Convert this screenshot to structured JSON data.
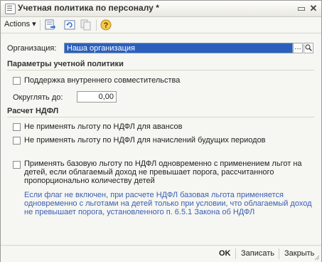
{
  "window": {
    "title": "Учетная политика по персоналу *",
    "restore_glyph": "▭",
    "close_glyph": "✕"
  },
  "toolbar": {
    "actions_label": "Actions",
    "actions_arrow": "▾",
    "icons": [
      "save-close-icon",
      "refresh-icon",
      "copy-icon",
      "help-icon"
    ],
    "help_glyph": "?"
  },
  "form": {
    "org_label": "Организация:",
    "org_value": "Наша организация",
    "org_select_glyph": "…",
    "org_open_glyph": "🔍",
    "section_policy": "Параметры учетной политики",
    "internal_combination_label": "Поддержка внутреннего совместительства",
    "internal_combination_checked": false,
    "round_label": "Округлять до:",
    "round_value": "0,00",
    "section_ndfl": "Расчет НДФЛ",
    "no_benefit_advances_label": "Не применять льготу по НДФЛ для авансов",
    "no_benefit_advances_checked": false,
    "no_benefit_future_label": "Не применять льготу по НДФЛ для начислений будущих периодов",
    "no_benefit_future_checked": false,
    "base_benefit_label_line1": "Применять базовую льготу по НДФЛ одновременно с применением льгот на",
    "base_benefit_label_line2": "детей, если облагаемый доход не превышает порога, рассчитанного",
    "base_benefit_label_line3": "пропорционально количеству детей",
    "base_benefit_checked": false,
    "info_line1": "Если флаг не включен, при расчете НДФЛ базовая льгота применяется",
    "info_line2": "одновременно с льготами на детей только при условии, что облагаемый доход",
    "info_line3": "не превышает порога, установленного п. 6.5.1 Закона об НДФЛ",
    "info_color": "#3a5fb0"
  },
  "footer": {
    "ok_label": "OK",
    "save_label": "Записать",
    "close_label": "Закрыть"
  },
  "colors": {
    "selection": "#2c5fbd",
    "section_line": "#d8d4c6"
  }
}
